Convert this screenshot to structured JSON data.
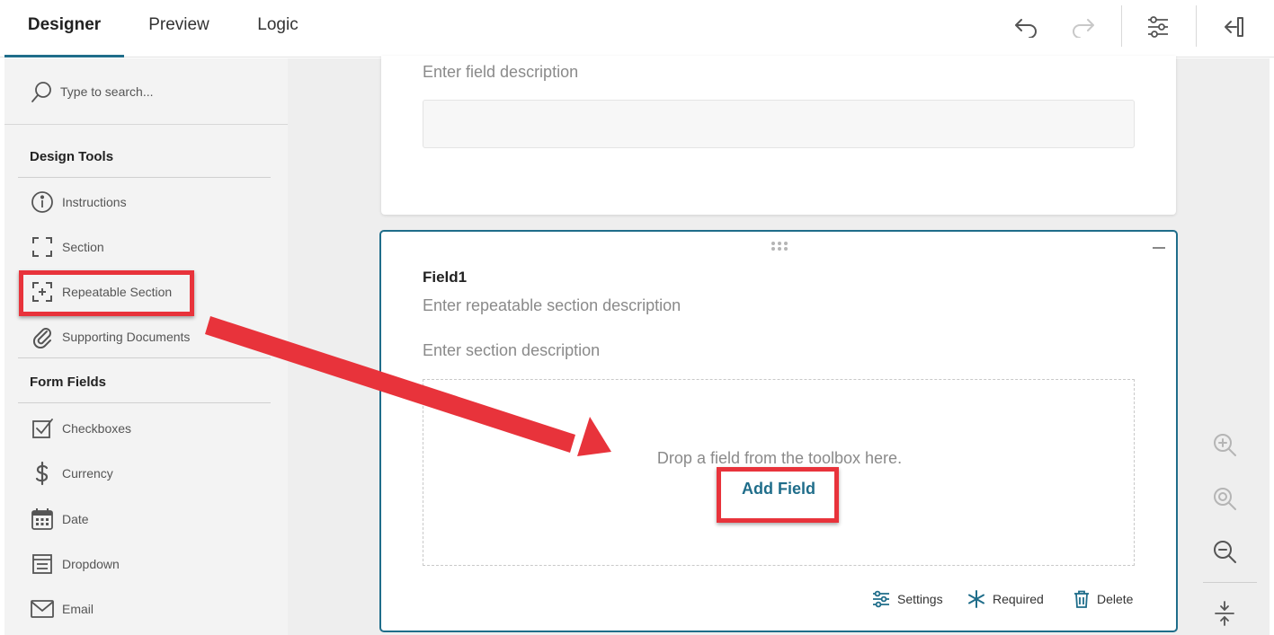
{
  "tabs": [
    {
      "label": "Designer",
      "active": true
    },
    {
      "label": "Preview",
      "active": false
    },
    {
      "label": "Logic",
      "active": false
    }
  ],
  "toolbar_icons": [
    "undo-icon",
    "redo-icon",
    "settings-sliders-icon",
    "collapse-panel-icon"
  ],
  "sidebar": {
    "search_placeholder": "Type to search...",
    "design_tools_title": "Design Tools",
    "design_tools": [
      {
        "label": "Instructions",
        "icon": "info-circle-icon"
      },
      {
        "label": "Section",
        "icon": "section-bracket-icon"
      },
      {
        "label": "Repeatable Section",
        "icon": "repeatable-section-icon"
      },
      {
        "label": "Supporting Documents",
        "icon": "paperclip-icon"
      }
    ],
    "form_fields_title": "Form Fields",
    "form_fields": [
      {
        "label": "Checkboxes",
        "icon": "checkbox-icon"
      },
      {
        "label": "Currency",
        "icon": "dollar-icon"
      },
      {
        "label": "Date",
        "icon": "calendar-icon"
      },
      {
        "label": "Dropdown",
        "icon": "dropdown-list-icon"
      },
      {
        "label": "Email",
        "icon": "envelope-icon"
      }
    ]
  },
  "canvas": {
    "top_card": {
      "description_placeholder": "Enter field description"
    },
    "section_card": {
      "title": "Field1",
      "repeatable_description": "Enter repeatable section description",
      "section_description": "Enter section description",
      "drop_text": "Drop a field from the toolbox here.",
      "add_field_label": "Add Field",
      "actions": [
        {
          "label": "Settings",
          "icon": "settings-sliders-icon"
        },
        {
          "label": "Required",
          "icon": "asterisk-icon"
        },
        {
          "label": "Delete",
          "icon": "trash-icon"
        }
      ]
    },
    "zoom_controls": [
      "zoom-in-icon",
      "zoom-reset-icon",
      "zoom-out-icon",
      "fit-vertical-icon"
    ]
  },
  "colors": {
    "accent": "#1f6d8a",
    "highlight": "#e8333b",
    "sidebar_bg": "#f3f3f3",
    "canvas_bg": "#eeeeee"
  }
}
